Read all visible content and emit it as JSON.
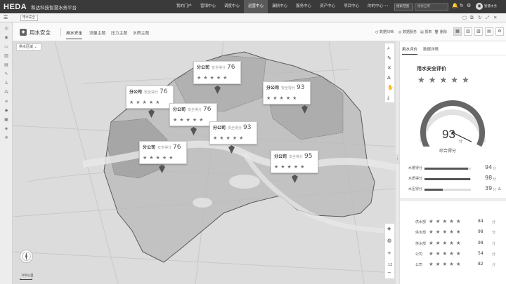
{
  "header": {
    "logo": "HEDA",
    "platform_title": "和达科技智慧水务平台",
    "nav": [
      "我的门户",
      "营销中心",
      "调度中心",
      "运营中心",
      "漏损中心",
      "服务中心",
      "资产中心",
      "项目中心",
      "的的中心"
    ],
    "active_nav_index": 3,
    "more": "···",
    "search_scope": "搜索范围",
    "search_placeholder": "搜索应用",
    "username": "智慧水务"
  },
  "tabbar": {
    "page_tab": "用水安全"
  },
  "module": {
    "title": "用水安全",
    "subtabs": [
      "用水安全",
      "流量主题",
      "压力主题",
      "水质主题"
    ],
    "active_subtab": 0,
    "actions": [
      "数据归档",
      "数据服务",
      "报表",
      "删除"
    ]
  },
  "map": {
    "region_select": "供水区域",
    "zoom": "12",
    "scale": "100公里",
    "cards": [
      {
        "company": "分公司",
        "label": "安全得分",
        "score": "76",
        "stars": "★★★★★"
      },
      {
        "company": "分公司",
        "label": "安全得分",
        "score": "76",
        "stars": "★★★★★"
      },
      {
        "company": "分公司",
        "label": "安全得分",
        "score": "76",
        "stars": "★★★★★"
      },
      {
        "company": "分公司",
        "label": "安全得分",
        "score": "93",
        "stars": "★★★★★"
      },
      {
        "company": "分公司",
        "label": "安全得分",
        "score": "93",
        "stars": "★★★★★"
      },
      {
        "company": "分公司",
        "label": "安全得分",
        "score": "76",
        "stars": "★★★★★"
      },
      {
        "company": "分公司",
        "label": "安全得分",
        "score": "95",
        "stars": "★★★★★"
      }
    ]
  },
  "panel": {
    "tabs": [
      "用水评价",
      "数据详情"
    ],
    "active_tab": 0,
    "title": "用水安全评价",
    "stars": "★★★★★",
    "gauge": {
      "score": "93",
      "unit": "分",
      "label": "综合得分",
      "value": 93,
      "max": 100
    },
    "metrics": [
      {
        "label": "水量得分",
        "value": "94",
        "unit": "分",
        "fill": 0.94,
        "warn": ""
      },
      {
        "label": "水质得分",
        "value": "98",
        "unit": "分",
        "fill": 0.98,
        "warn": ""
      },
      {
        "label": "水压得分",
        "value": "39",
        "unit": "分",
        "fill": 0.39,
        "warn": "⚠"
      }
    ],
    "ranking": [
      {
        "name": "供水部",
        "stars": "★★★★★",
        "value": "84",
        "unit": "分"
      },
      {
        "name": "供水部",
        "stars": "★★★★★",
        "value": "98",
        "unit": "分"
      },
      {
        "name": "供水部",
        "stars": "★★★★★",
        "value": "98",
        "unit": "分"
      },
      {
        "name": "公司",
        "stars": "★★★★★",
        "value": "54",
        "unit": "分"
      },
      {
        "name": "公司",
        "stars": "★★★★★",
        "value": "82",
        "unit": "分"
      }
    ]
  }
}
